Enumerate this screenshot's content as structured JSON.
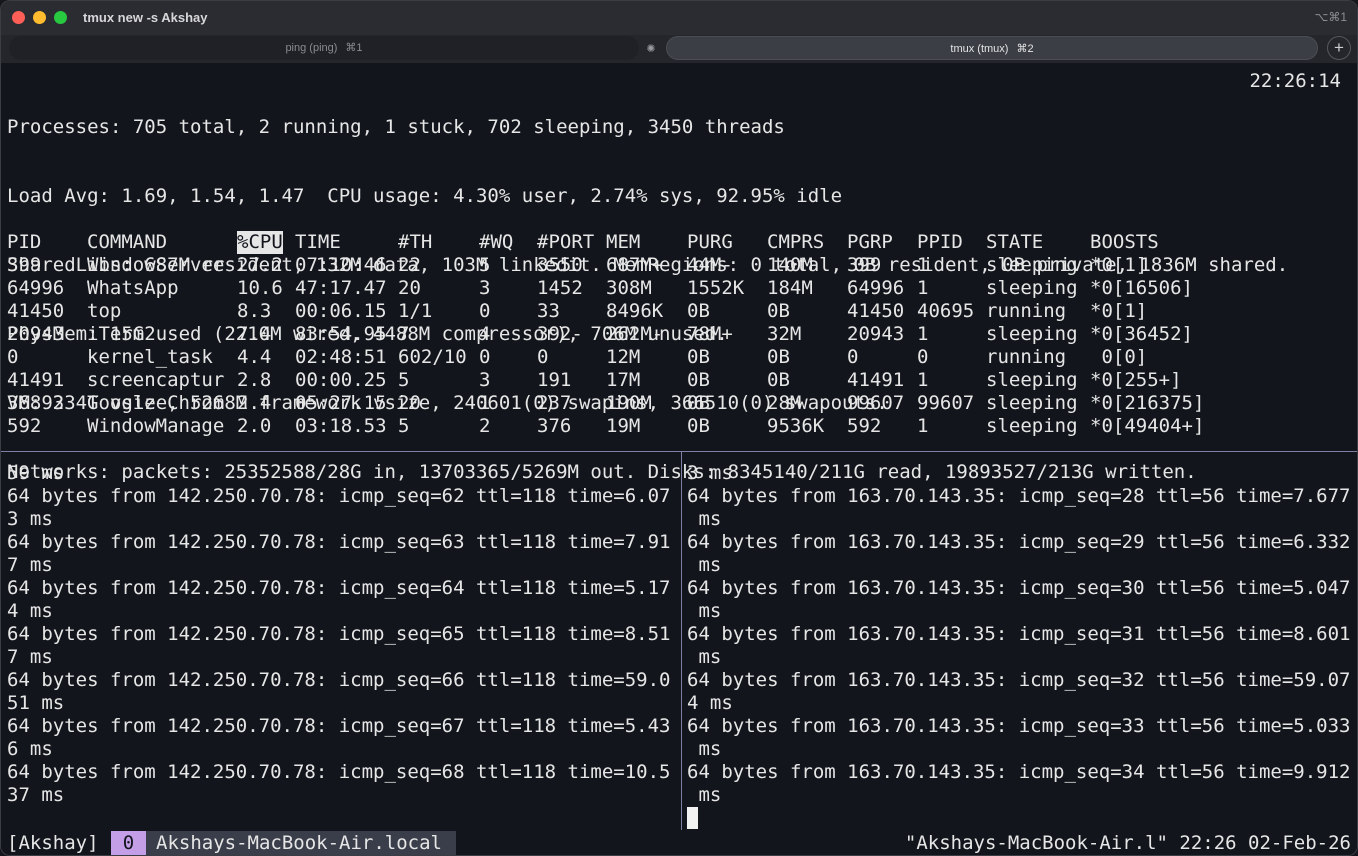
{
  "window": {
    "title": "tmux new -s Akshay",
    "shortcut": "⌥⌘1"
  },
  "tabs": [
    {
      "label": "ping (ping)",
      "shortcut": "⌘1"
    },
    {
      "label": "tmux (tmux)",
      "shortcut": "⌘2"
    }
  ],
  "top": {
    "clock": "22:26:14",
    "summary": [
      "Processes: 705 total, 2 running, 1 stuck, 702 sleeping, 3450 threads",
      "Load Avg: 1.69, 1.54, 1.47  CPU usage: 4.30% user, 2.74% sys, 92.95% idle",
      "SharedLibs: 687M resident, 132M data, 103M linkedit. MemRegions: 0 total, 0B resident, 0B private, 1836M shared.",
      "PhysMem: 15G used (2210M wired, 4488M compressor), 706M unused.",
      "VM: 334T vsize, 5268M framework vsize, 240601(0) swapins, 366510(0) swapouts.",
      "Networks: packets: 25352588/28G in, 13703365/5269M out. Disks: 8345140/211G read, 19893527/213G written."
    ],
    "columns": [
      "PID",
      "COMMAND",
      "%CPU",
      "TIME",
      "#TH",
      "#WQ",
      "#PORT",
      "MEM",
      "PURG",
      "CMPRS",
      "PGRP",
      "PPID",
      "STATE",
      "BOOSTS"
    ],
    "rows": [
      [
        "399",
        "WindowServer",
        "27.2",
        "07:10:46",
        "22",
        "5",
        "3550",
        "687M+",
        "44M-",
        "140M",
        "399",
        "1",
        "sleeping",
        "*0[1]"
      ],
      [
        "64996",
        "WhatsApp",
        "10.6",
        "47:17.47",
        "20",
        "3",
        "1452",
        "308M",
        "1552K",
        "184M",
        "64996",
        "1",
        "sleeping",
        "*0[16506]"
      ],
      [
        "41450",
        "top",
        "8.3",
        "00:06.15",
        "1/1",
        "0",
        "33",
        "8496K",
        "0B",
        "0B",
        "41450",
        "40695",
        "running",
        "*0[1]"
      ],
      [
        "20943",
        "iTerm2",
        "7.4",
        "83:54.95",
        "7",
        "4",
        "392-",
        "262M-",
        "78M+",
        "32M",
        "20943",
        "1",
        "sleeping",
        "*0[36452]"
      ],
      [
        "0",
        "kernel_task",
        "4.4",
        "02:48:51",
        "602/10",
        "0",
        "0",
        "12M",
        "0B",
        "0B",
        "0",
        "0",
        "running",
        " 0[0]"
      ],
      [
        "41491",
        "screencaptur",
        "2.8",
        "00:00.25",
        "5",
        "3",
        "191",
        "17M",
        "0B",
        "0B",
        "41491",
        "1",
        "sleeping",
        "*0[255+]"
      ],
      [
        "36892",
        "Google Chrom",
        "2.4",
        "05:27.15",
        "20",
        "1",
        "237",
        "190M",
        "0B",
        "28M",
        "99607",
        "99607",
        "sleeping",
        "*0[216375]"
      ],
      [
        "592",
        "WindowManage",
        "2.0",
        "03:18.53",
        "5",
        "2",
        "376",
        "19M",
        "0B",
        "9536K",
        "592",
        "1",
        "sleeping",
        "*0[49404+]"
      ]
    ]
  },
  "ping_left": [
    "59 ms",
    "64 bytes from 142.250.70.78: icmp_seq=62 ttl=118 time=6.07",
    "3 ms",
    "64 bytes from 142.250.70.78: icmp_seq=63 ttl=118 time=7.91",
    "7 ms",
    "64 bytes from 142.250.70.78: icmp_seq=64 ttl=118 time=5.17",
    "4 ms",
    "64 bytes from 142.250.70.78: icmp_seq=65 ttl=118 time=8.51",
    "7 ms",
    "64 bytes from 142.250.70.78: icmp_seq=66 ttl=118 time=59.0",
    "51 ms",
    "64 bytes from 142.250.70.78: icmp_seq=67 ttl=118 time=5.43",
    "6 ms",
    "64 bytes from 142.250.70.78: icmp_seq=68 ttl=118 time=10.5",
    "37 ms"
  ],
  "ping_right": [
    "3 ms",
    "64 bytes from 163.70.143.35: icmp_seq=28 ttl=56 time=7.677",
    " ms",
    "64 bytes from 163.70.143.35: icmp_seq=29 ttl=56 time=6.332",
    " ms",
    "64 bytes from 163.70.143.35: icmp_seq=30 ttl=56 time=5.047",
    " ms",
    "64 bytes from 163.70.143.35: icmp_seq=31 ttl=56 time=8.601",
    " ms",
    "64 bytes from 163.70.143.35: icmp_seq=32 ttl=56 time=59.07",
    "4 ms",
    "64 bytes from 163.70.143.35: icmp_seq=33 ttl=56 time=5.033",
    " ms",
    "64 bytes from 163.70.143.35: icmp_seq=34 ttl=56 time=9.912",
    " ms"
  ],
  "status": {
    "session": "[Akshay]",
    "window_index": "0",
    "window_name": "Akshays-MacBook-Air.local",
    "right": "\"Akshays-MacBook-Air.l\" 22:26 02-Feb-26"
  }
}
